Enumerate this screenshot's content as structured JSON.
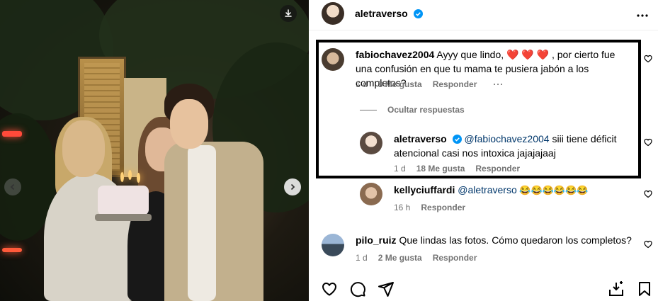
{
  "post": {
    "author": "aletraverso",
    "verified": true
  },
  "comments": [
    {
      "user": "fabiochavez2004",
      "text": "Ayyy que lindo, ❤️ ❤️ ❤️ , por cierto fue una confusión en que tu mama te pusiera jabón a los completos?",
      "time": "1 d",
      "likes": "3 Me gusta",
      "reply_label": "Responder",
      "more_label": "···"
    },
    {
      "user": "aletraverso",
      "mention": "@fabiochavez2004",
      "text": " siii tiene déficit atencional casi nos intoxica jajajajaaj",
      "time": "1 d",
      "likes": "18 Me gusta",
      "reply_label": "Responder"
    },
    {
      "user": "kellyciuffardi",
      "mention": "@aletraverso",
      "text": " 😂😂😂😂😂😂",
      "time": "16 h",
      "reply_label": "Responder"
    },
    {
      "user": "pilo_ruiz",
      "text": "Que lindas las fotos. Cómo quedaron los completos?",
      "time": "1 d",
      "likes": "2 Me gusta",
      "reply_label": "Responder"
    }
  ],
  "hide_replies_label": "Ocultar respuestas",
  "colors": {
    "verified": "#0095f6",
    "meta": "#737373",
    "mention": "#00376b",
    "highlight_border": "#000000"
  },
  "icons": {
    "download": "download-icon",
    "prev": "chevron-left-icon",
    "next": "chevron-right-icon",
    "more": "more-horizontal-icon",
    "like": "heart-icon",
    "comment": "comment-icon",
    "share": "send-icon",
    "save_plus": "save-to-collection-icon",
    "bookmark": "bookmark-icon"
  }
}
